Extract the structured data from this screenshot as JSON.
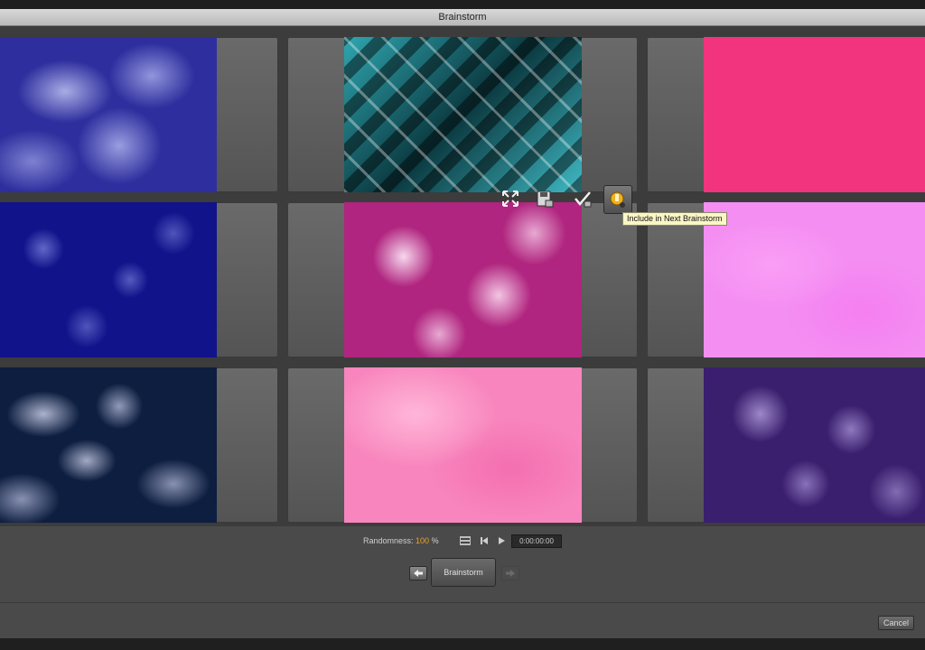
{
  "window": {
    "title": "Brainstorm"
  },
  "variations": [
    {
      "id": "r1c1",
      "swatch": "blue-cloud",
      "color": "#2e2e9e"
    },
    {
      "id": "r1c2",
      "swatch": "teal-diamond",
      "color": "#2fa6b0"
    },
    {
      "id": "r1c3",
      "swatch": "pink-noise",
      "color": "#f2347e"
    },
    {
      "id": "r2c1",
      "swatch": "navy-speckle",
      "color": "#10138a"
    },
    {
      "id": "r2c2",
      "swatch": "magenta-marble",
      "color": "#b0257f"
    },
    {
      "id": "r2c3",
      "swatch": "light-violet",
      "color": "#f48ef2"
    },
    {
      "id": "r3c1",
      "swatch": "dark-cloud",
      "color": "#0d1e40"
    },
    {
      "id": "r3c2",
      "swatch": "soft-pink",
      "color": "#f885bd"
    },
    {
      "id": "r3c3",
      "swatch": "purple-cloud",
      "color": "#3a1f6e"
    }
  ],
  "hover_toolbar": {
    "icons": [
      "expand-icon",
      "save-icon",
      "apply-icon",
      "include-icon"
    ],
    "tooltip": "Include in Next Brainstorm"
  },
  "controls": {
    "randomness_label": "Randomness:",
    "randomness_value": "100",
    "randomness_unit": "%",
    "timecode": "0:00:00:00"
  },
  "brainstorm_button": "Brainstorm",
  "cancel_button": "Cancel",
  "colors": {
    "accent": "#f0a020",
    "tooltip_bg": "#fbf6c6"
  }
}
